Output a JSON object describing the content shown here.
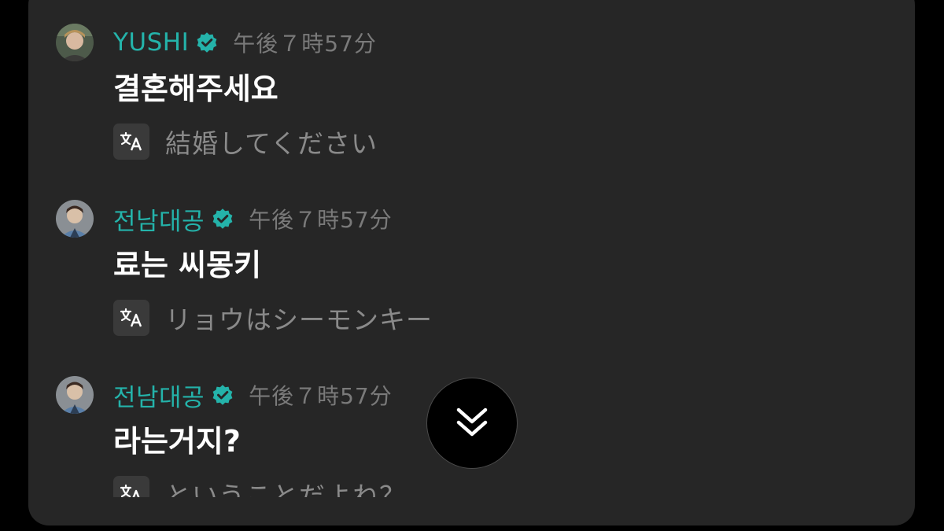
{
  "messages": [
    {
      "author": "YUSHI",
      "time": "午後７時57分",
      "text": "결혼해주세요",
      "translation": "結婚してください",
      "avatar_icon": "user-avatar",
      "verified_color": "#24b3aa"
    },
    {
      "author": "전남대공",
      "time": "午後７時57分",
      "text": "료는 씨몽키",
      "translation": "リョウはシーモンキー",
      "avatar_icon": "user-avatar",
      "verified_color": "#24b3aa"
    },
    {
      "author": "전남대공",
      "time": "午後７時57分",
      "text": "라는거지?",
      "translation": "ということだよね？",
      "avatar_icon": "user-avatar",
      "verified_color": "#24b3aa"
    }
  ],
  "controls": {
    "translate_icon": "translate-icon",
    "scroll_down_icon": "double-chevron-down-icon"
  },
  "colors": {
    "background": "#000000",
    "panel": "#262626",
    "accent": "#24b3aa",
    "secondary_text": "#7a7a7a"
  }
}
